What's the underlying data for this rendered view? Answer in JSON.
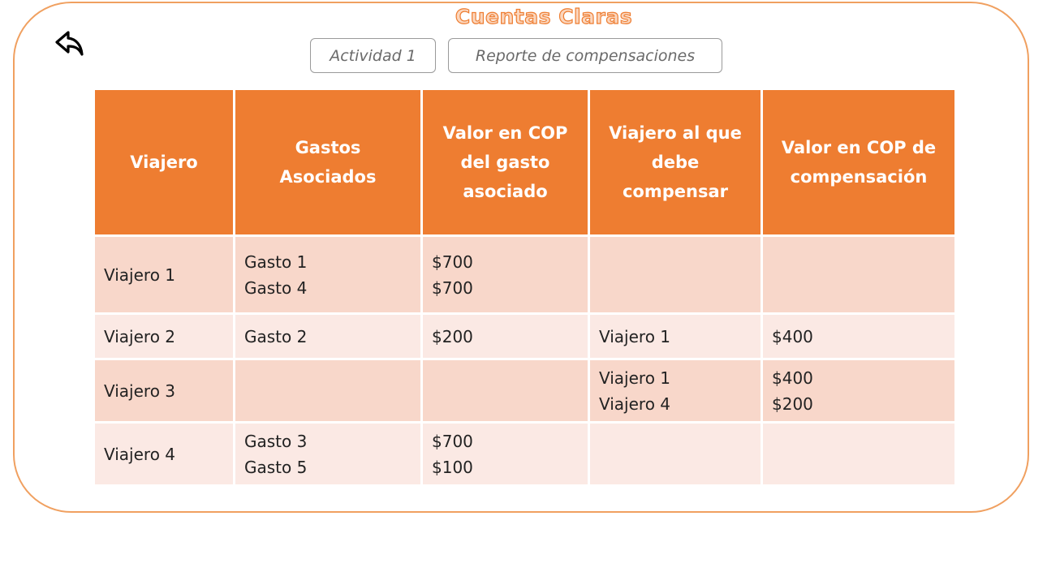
{
  "app": {
    "title": "Cuentas Claras"
  },
  "nav": {
    "back_icon": "undo-arrow-icon",
    "tabs": [
      {
        "label": "Actividad 1"
      },
      {
        "label": "Reporte de compensaciones"
      }
    ]
  },
  "colors": {
    "accent": "#ee7d31",
    "header_text": "#ffffff",
    "row_dark": "#f8d7ca",
    "row_light": "#fbe9e4",
    "frame_border": "#f0a060"
  },
  "table": {
    "headers": [
      [
        "Viajero"
      ],
      [
        "Gastos",
        "Asociados"
      ],
      [
        "Valor en COP",
        "del gasto",
        "asociado"
      ],
      [
        "Viajero al que",
        "debe",
        "compensar"
      ],
      [
        "Valor en COP de",
        "compensación"
      ]
    ],
    "rows": [
      {
        "traveler": "Viajero 1",
        "expenses": [
          "Gasto 1",
          "Gasto 4"
        ],
        "expense_values": [
          "$700",
          "$700"
        ],
        "compensate_to": [
          "",
          ""
        ],
        "compensation_values": [
          "",
          ""
        ]
      },
      {
        "traveler": "Viajero 2",
        "expenses": [
          "Gasto 2",
          ""
        ],
        "expense_values": [
          "$200",
          ""
        ],
        "compensate_to": [
          "Viajero 1",
          ""
        ],
        "compensation_values": [
          "$400",
          ""
        ]
      },
      {
        "traveler": "Viajero 3",
        "expenses": [
          "",
          ""
        ],
        "expense_values": [
          "",
          ""
        ],
        "compensate_to": [
          "Viajero 1",
          "Viajero 4"
        ],
        "compensation_values": [
          "$400",
          "$200"
        ]
      },
      {
        "traveler": "Viajero 4",
        "expenses": [
          "Gasto 3",
          "Gasto 5"
        ],
        "expense_values": [
          "$700",
          "$100"
        ],
        "compensate_to": [
          "",
          ""
        ],
        "compensation_values": [
          "",
          ""
        ]
      }
    ]
  }
}
